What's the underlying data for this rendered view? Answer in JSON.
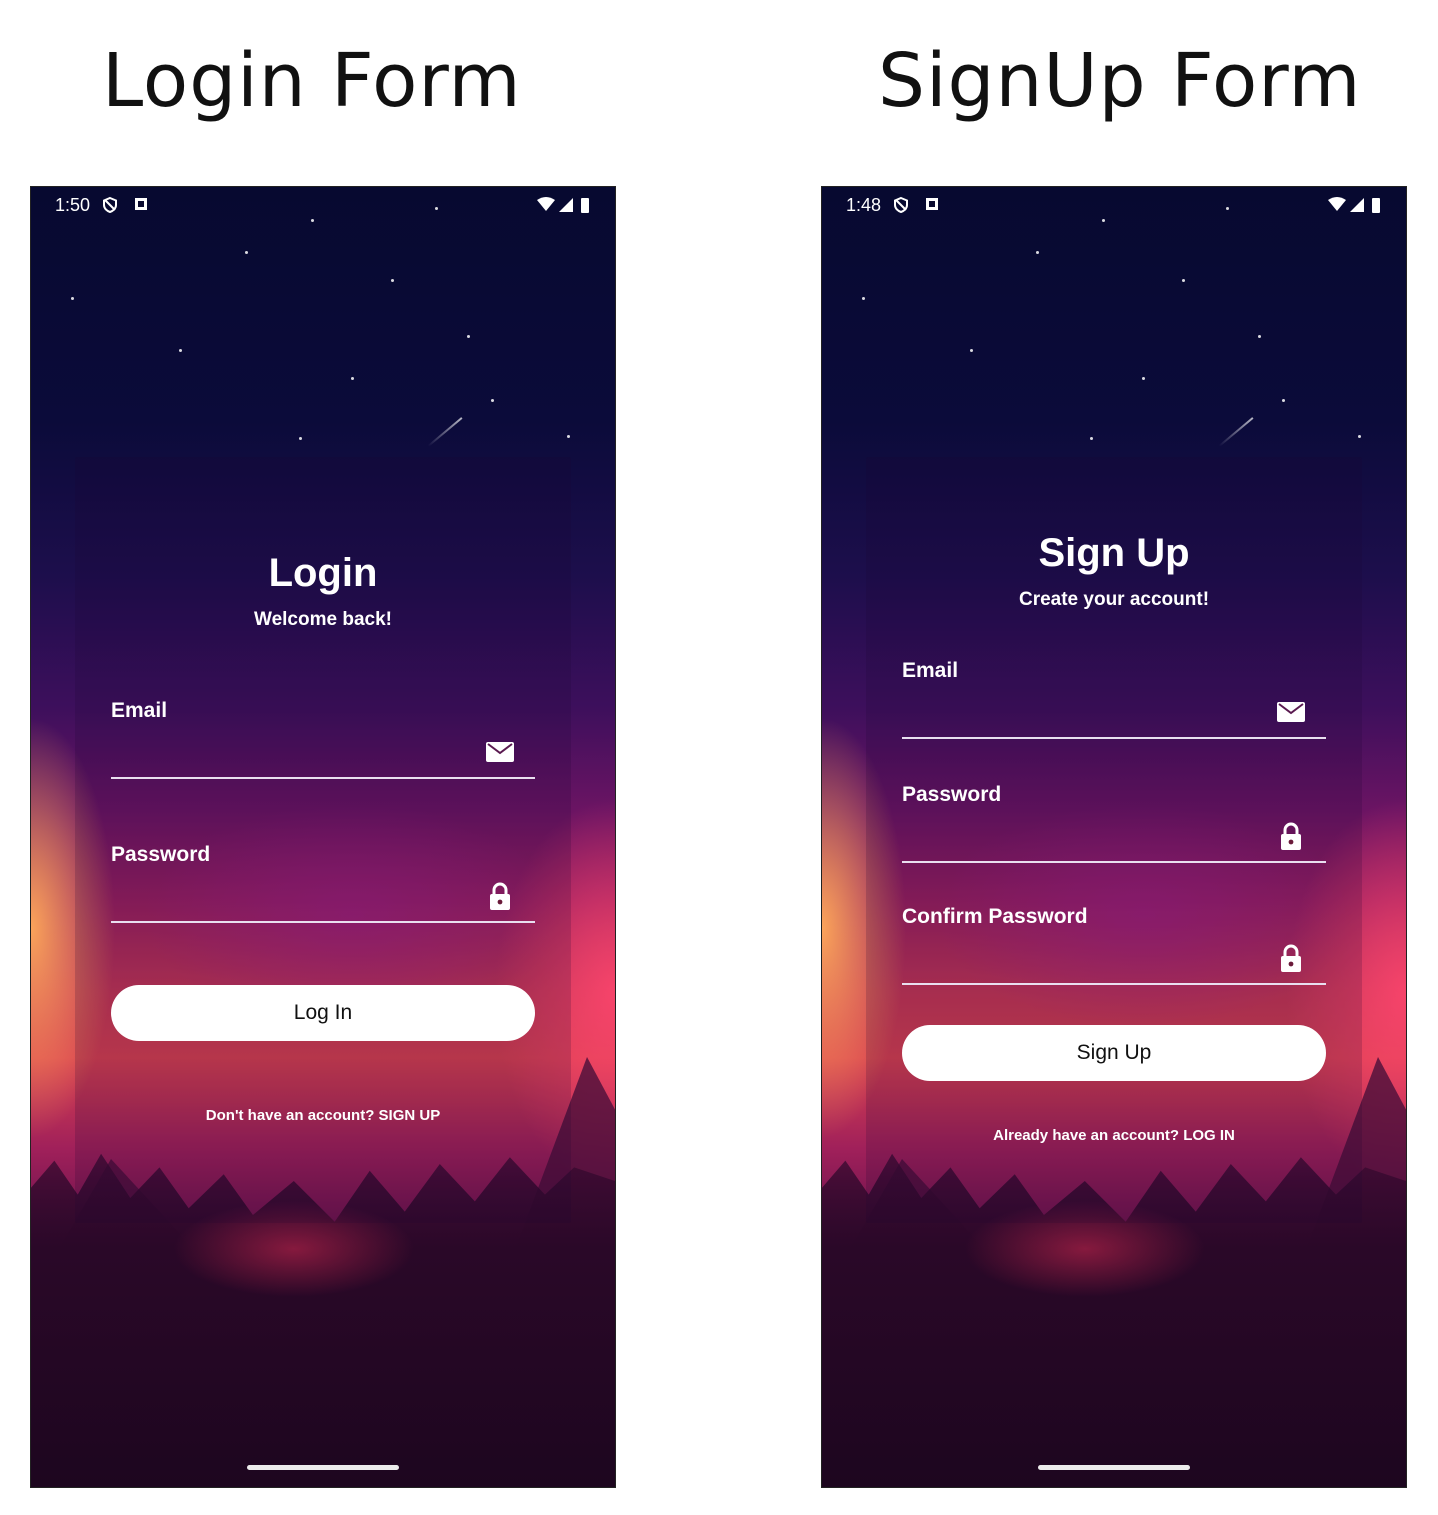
{
  "headings": {
    "login": "Login Form",
    "signup": "SignUp Form"
  },
  "login": {
    "status_time": "1:50",
    "title": "Login",
    "subtitle": "Welcome back!",
    "email_label": "Email",
    "email_value": "",
    "password_label": "Password",
    "password_value": "",
    "button_label": "Log In",
    "switch_text": "Don't have an account? SIGN UP"
  },
  "signup": {
    "status_time": "1:48",
    "title": "Sign Up",
    "subtitle": "Create your account!",
    "email_label": "Email",
    "email_value": "",
    "password_label": "Password",
    "password_value": "",
    "confirm_label": "Confirm Password",
    "confirm_value": "",
    "button_label": "Sign Up",
    "switch_text": "Already have an account? LOG IN"
  },
  "icons": {
    "email": "mail-icon",
    "password": "lock-icon",
    "status_left": [
      "shield-icon",
      "sim-icon"
    ],
    "status_right": [
      "wifi-icon",
      "signal-icon",
      "battery-icon"
    ]
  },
  "colors": {
    "text": "#ffffff",
    "button_bg": "#ffffff",
    "button_text": "#111111",
    "underline": "#e9dff0"
  }
}
